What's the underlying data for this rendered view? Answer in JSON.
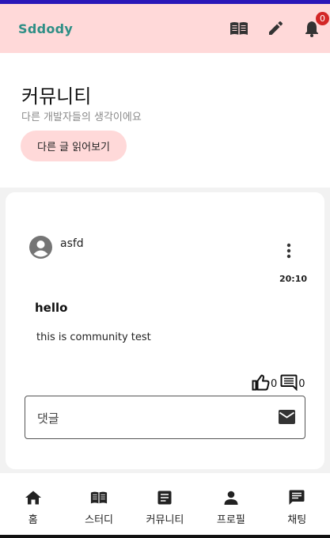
{
  "app": {
    "brand": "Sddody"
  },
  "appbar": {
    "icons": [
      "book-open-icon",
      "pencil-icon",
      "bell-icon"
    ],
    "notification_count": "0"
  },
  "header": {
    "title": "커뮤니티",
    "subtitle": "다른 개발자들의 생각이에요",
    "read_more_label": "다른 글 읽어보기"
  },
  "post": {
    "author": "asfd",
    "time": "20:10",
    "title": "hello",
    "body": "this is community test",
    "likes": "0",
    "comments": "0"
  },
  "comment": {
    "placeholder": "댓글"
  },
  "nav": {
    "items": [
      {
        "label": "홈",
        "icon": "home-icon"
      },
      {
        "label": "스터디",
        "icon": "book-icon"
      },
      {
        "label": "커뮤니티",
        "icon": "article-icon"
      },
      {
        "label": "프로필",
        "icon": "person-icon"
      },
      {
        "label": "채팅",
        "icon": "chat-icon"
      }
    ]
  },
  "colors": {
    "appbar": "#ffd9d9",
    "brand": "#2f8f86",
    "status_bar": "#2a17b8",
    "badge": "#d32626"
  }
}
